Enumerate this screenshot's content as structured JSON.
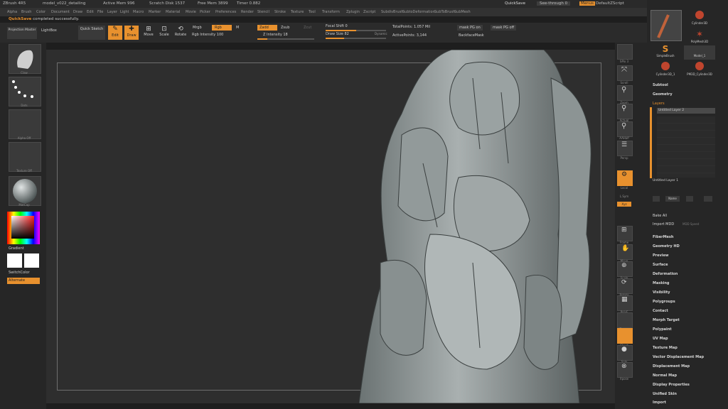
{
  "titlebar": {
    "app": "ZBrush 4R5",
    "doc": "model_v022_detailing",
    "active_mem": "Active Mem 996",
    "scratch_disk": "Scratch Disk 1537",
    "free_mem": "Free Mem 3899",
    "timer": "Timer 0.882",
    "quicksave": "QuickSave",
    "see_through": "See-through 0",
    "menus": "Menus",
    "default_script": "DefaultZScript"
  },
  "menubar": [
    "Alpha",
    "Brush",
    "Color",
    "Document",
    "Draw",
    "Edit",
    "File",
    "Layer",
    "Light",
    "Macro",
    "Marker",
    "Material",
    "Movie",
    "Picker",
    "Preferences",
    "Render",
    "Stencil",
    "Stroke",
    "Texture",
    "Tool",
    "Transform",
    "Zplugin",
    "Zscript",
    "SubdivBrush",
    "SubtoDeformation",
    "SubToBrush",
    "SubMesh"
  ],
  "notice": {
    "prefix": "QuickSave",
    "message": "completed successfully."
  },
  "toolbar": {
    "projection_master": "Projection Master",
    "lightbox": "LightBox",
    "quick_sketch": "Quick Sketch",
    "edit": "Edit",
    "draw": "Draw",
    "move": "Move",
    "scale": "Scale",
    "rotate": "Rotate",
    "mrgb": "Mrgb",
    "rgb": "Rgb",
    "m": "M",
    "rgb_intensity": "Rgb Intensity 100",
    "zadd": "Zadd",
    "zsub": "Zsub",
    "zcut": "Zcut",
    "z_intensity": "Z Intensity 18",
    "focal_shift": "Focal Shift 0",
    "draw_size": "Draw Size 82",
    "dynamic": "Dynamic",
    "total_points": "TotalPoints: 1.057 Mil",
    "active_points": "ActivePoints: 3,144",
    "mask_pg_on": "mask PG on",
    "mask_pg_off": "mask PG off",
    "backface_mask": "BackfaceMask",
    "z_intensity_level": 0.18,
    "focal_shift_level": 0.5,
    "draw_size_level": 0.3
  },
  "left_panel": {
    "thumbs": [
      "Claw",
      "Dots",
      "Alpha Off",
      "Texture Off",
      "MatCap"
    ],
    "gradient": "Gradient",
    "switch_color": "SwitchColor",
    "alternate": "Alternate"
  },
  "right_tools": [
    "BPR",
    "SPix 3",
    "Scroll",
    "Zoom",
    "Actual",
    "AAHalf",
    "Persp",
    "Floor",
    "Local",
    "L.Sym",
    "Xyz",
    "Frame",
    "Move",
    "Scale",
    "Rotate",
    "PolyF",
    "Transp",
    "Ghost",
    "Solo",
    "Xpose"
  ],
  "right_panel": {
    "tool_thumbs": [
      "Cylinder3D",
      "PolyMesh3D",
      "SimpleBrush",
      "Model_1",
      "Cylinder3D_1",
      "PM3D_Cylinder3D"
    ],
    "subtool": "Subtool",
    "geometry": "Geometry",
    "layers": "Layers",
    "layer_top": "Untitled Layer 2",
    "layer_bottom": "Untitled Layer 1",
    "name_btn": "Name",
    "bake_all": "Bake All",
    "import_mdd": "Import MDD",
    "speed": "MDD Speed",
    "sections": [
      "FiberMesh",
      "Geometry HD",
      "Preview",
      "Surface",
      "Deformation",
      "Masking",
      "Visibility",
      "Polygroups",
      "Contact",
      "Morph Target",
      "Polypaint",
      "UV Map",
      "Texture Map",
      "Vector Displacement Map",
      "Displacement Map",
      "Normal Map",
      "Display Properties",
      "Unified Skin",
      "Import"
    ]
  },
  "colors": {
    "accent": "#e8912e",
    "panel": "#262626",
    "canvas": "#2e2e2e"
  }
}
